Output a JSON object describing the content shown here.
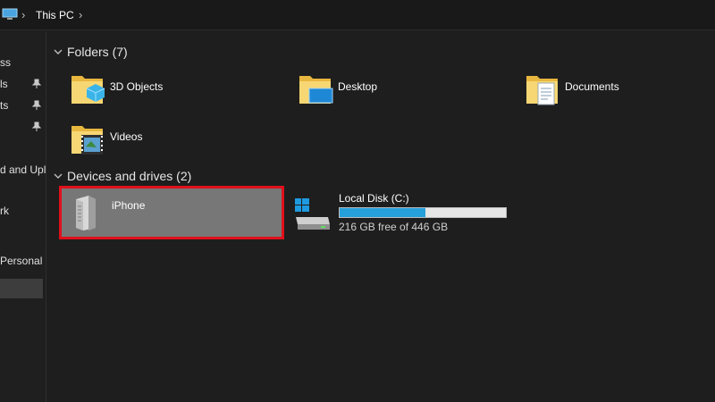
{
  "address_bar": {
    "icon": "this-pc-icon",
    "breadcrumb": "This PC"
  },
  "navigation": {
    "items": [
      {
        "label": "ss",
        "pinned": false
      },
      {
        "label": "ls",
        "pinned": true
      },
      {
        "label": "ts",
        "pinned": true
      },
      {
        "label": "",
        "pinned": true
      },
      {
        "label": "d and Upl",
        "pinned": false
      },
      {
        "label": "rk",
        "pinned": false
      },
      {
        "label": "Personal",
        "pinned": false
      }
    ]
  },
  "groups": {
    "folders": {
      "header": "Folders (7)",
      "items": [
        {
          "label": "3D Objects",
          "icon": "3d-objects-folder-icon"
        },
        {
          "label": "Desktop",
          "icon": "desktop-folder-icon"
        },
        {
          "label": "Documents",
          "icon": "documents-folder-icon"
        },
        {
          "label": "Videos",
          "icon": "videos-folder-icon"
        }
      ]
    },
    "devices": {
      "header": "Devices and drives (2)",
      "items": [
        {
          "label": "iPhone",
          "icon": "portable-device-icon",
          "selected": true
        },
        {
          "label": "Local Disk (C:)",
          "icon": "windows-drive-icon",
          "free_text": "216 GB free of 446 GB",
          "used_fraction": 0.516
        }
      ]
    }
  },
  "colors": {
    "background": "#1e1e1e",
    "selection": "#777777",
    "highlight_border": "#e0101b",
    "progress": "#26a0da"
  }
}
